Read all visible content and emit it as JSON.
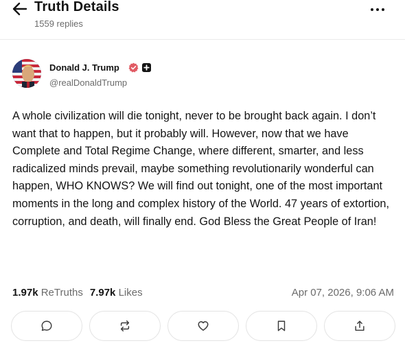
{
  "header": {
    "title": "Truth Details",
    "subtitle": "1559 replies"
  },
  "author": {
    "name": "Donald J. Trump",
    "handle": "@realDonaldTrump"
  },
  "post": {
    "text": "A whole civilization will die tonight, never to be brought back again. I don’t want that to happen, but it probably will. However, now that we have Complete and Total Regime Change, where different, smarter, and less radicalized minds prevail, maybe something revolutionarily wonderful can happen, WHO KNOWS? We will find out tonight, one of the most important moments in the long and complex history of the World. 47 years of extortion, corruption, and death, will finally end. God Bless the Great People of Iran!"
  },
  "stats": {
    "retruths_count": "1.97k",
    "retruths_label": "ReTruths",
    "likes_count": "7.97k",
    "likes_label": "Likes",
    "timestamp": "Apr 07, 2026, 9:06 AM"
  },
  "actions": [
    {
      "icon": "reply-icon"
    },
    {
      "icon": "retruth-icon"
    },
    {
      "icon": "heart-icon"
    },
    {
      "icon": "bookmark-icon"
    },
    {
      "icon": "share-icon"
    }
  ],
  "colors": {
    "text": "#141414",
    "muted": "#6b6b6b",
    "verified": "#e15b64",
    "border": "#e3e3e3"
  }
}
